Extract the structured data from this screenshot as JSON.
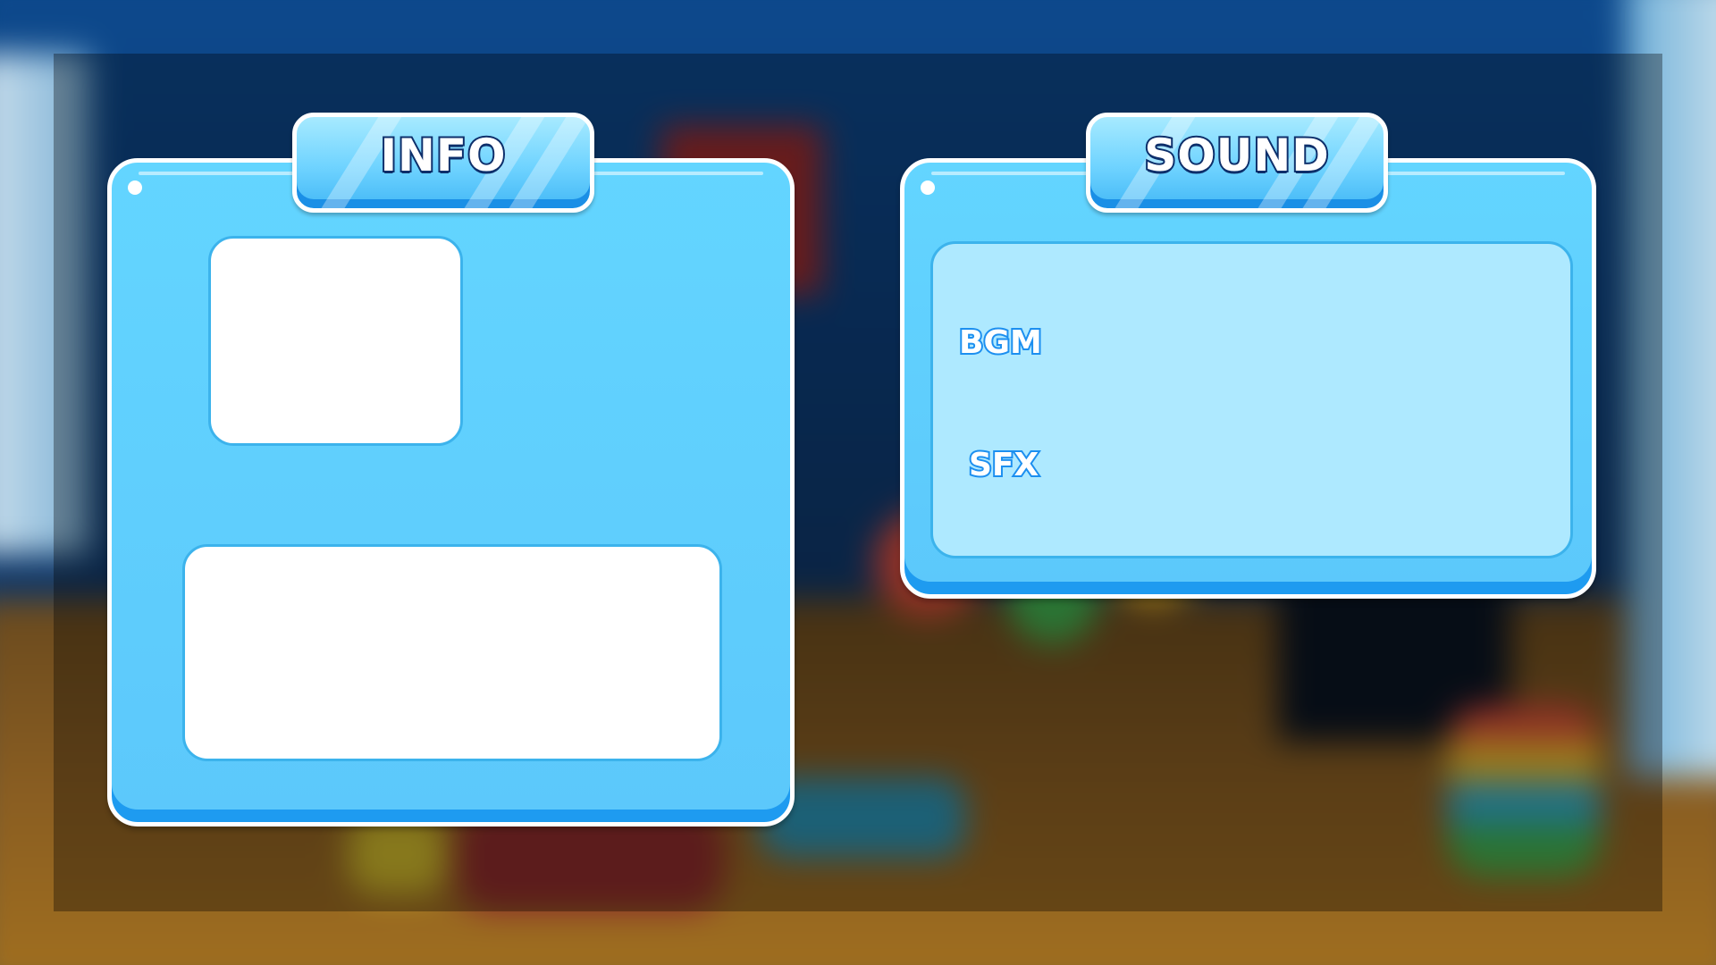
{
  "info_panel": {
    "title": "INFO"
  },
  "sound_panel": {
    "title": "SOUND",
    "bgm_label": "BGM",
    "sfx_label": "SFX"
  },
  "colors": {
    "panel_blue": "#63d5ff",
    "panel_dark_edge": "#1e9bf0",
    "title_outline": "#0d2f6b",
    "label_outline": "#1c8ff0",
    "sound_inner": "#aee9ff"
  }
}
